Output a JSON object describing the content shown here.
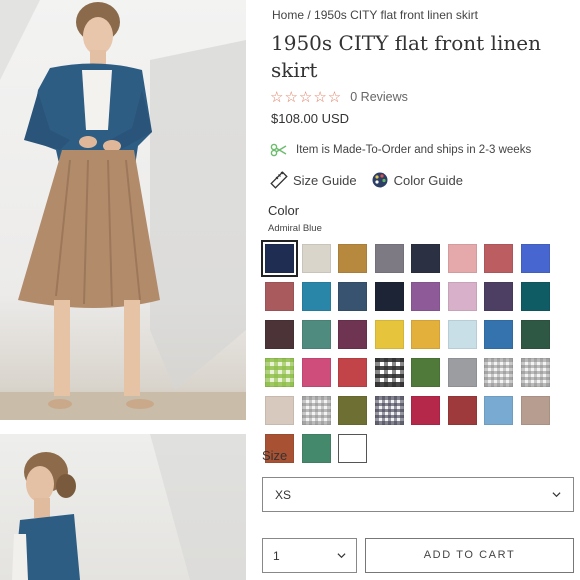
{
  "breadcrumb": {
    "home": "Home",
    "separator": "/",
    "current": "1950s CITY flat front linen skirt"
  },
  "product": {
    "title": "1950s CITY flat front linen skirt",
    "reviews": "0 Reviews",
    "price": "$108.00 USD",
    "rating_icon": "star-outline-icon",
    "made_to_order": "Item is Made-To-Order and ships in 2-3 weeks"
  },
  "guides": {
    "size_guide": "Size Guide",
    "color_guide": "Color Guide"
  },
  "color": {
    "label": "Color",
    "selected": "Admiral Blue",
    "swatches": [
      "#1f2d52",
      "#d9d5cb",
      "#b7893f",
      "#7d7a84",
      "#2b3142",
      "#e5a9ac",
      "#bc5d62",
      "#4866cf",
      "#a95a5c",
      "#2a86a9",
      "#38536f",
      "#1d2436",
      "#8e5b98",
      "#d8b0c9",
      "#4d3f63",
      "#0f5c64",
      "#4b3338",
      "#4f8b7e",
      "#6e3451",
      "#e6c53d",
      "#e3b03c",
      "#c8dfe8",
      "#3573ae",
      "#2f5844",
      "gingham-green",
      "#cf4d7a",
      "#c34448",
      "gingham-black",
      "#4f7a3a",
      "#9c9da0",
      "gingham-soft",
      "gingham-soft",
      "#d8c9bf",
      "gingham-soft",
      "#6e7033",
      "gingham-navy",
      "#b6284a",
      "#9e3a3b",
      "#79aad2",
      "#b79d90",
      "#a95233",
      "#45896c",
      "#ffffff"
    ]
  },
  "size": {
    "label": "Size",
    "selected": "XS"
  },
  "quantity": {
    "selected": "1"
  },
  "cart": {
    "add_label": "ADD TO CART"
  },
  "accents": {
    "stars": "#e07e63",
    "leaf": "#6dbb6d"
  }
}
